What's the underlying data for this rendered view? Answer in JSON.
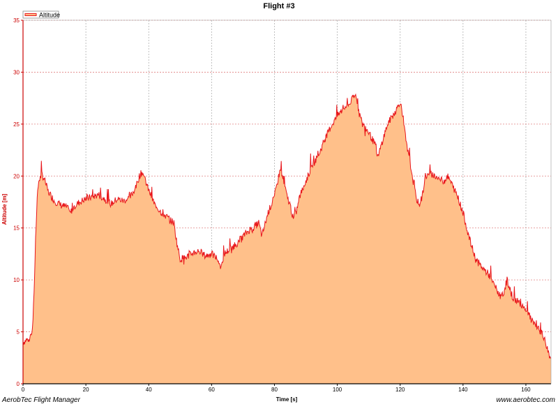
{
  "footer": {
    "left_text": "AerobTec Flight Manager",
    "right_text": "www.aerobtec.com"
  },
  "colors": {
    "fill": "#ffc08a",
    "line": "#e8161b",
    "grid": "#b0b0b0",
    "axis_y": "#cc0000",
    "axis_x": "#000000"
  },
  "chart_data": {
    "type": "area",
    "title": "Flight #3",
    "xlabel": "Time [s]",
    "ylabel": "Altitude [m]",
    "xlim": [
      0,
      168
    ],
    "ylim": [
      0,
      35
    ],
    "x_ticks": [
      0,
      20,
      40,
      60,
      80,
      100,
      120,
      140,
      160
    ],
    "y_ticks": [
      0,
      5,
      10,
      15,
      20,
      25,
      30,
      35
    ],
    "grid": true,
    "legend_position": "top-left",
    "series": [
      {
        "name": "Altitude",
        "x": [
          0,
          1,
          2,
          3,
          3.5,
          4,
          4.5,
          5,
          6,
          7,
          8,
          10,
          12,
          14,
          15,
          16,
          18,
          20,
          22,
          24,
          26,
          28,
          30,
          32,
          34,
          36,
          37,
          38,
          39,
          40,
          42,
          44,
          46,
          48,
          49,
          50,
          52,
          54,
          56,
          58,
          60,
          62,
          63,
          64,
          66,
          68,
          70,
          72,
          74,
          75,
          76,
          78,
          80,
          81,
          82,
          83,
          84,
          85,
          86,
          87,
          88,
          90,
          92,
          94,
          96,
          98,
          100,
          102,
          104,
          105,
          106,
          107,
          108,
          110,
          112,
          113,
          114,
          116,
          118,
          119,
          120,
          121,
          122,
          124,
          125,
          126,
          127,
          128,
          130,
          132,
          134,
          135,
          136,
          138,
          140,
          142,
          144,
          146,
          148,
          150,
          152,
          153,
          154,
          155,
          156,
          158,
          160,
          162,
          164,
          165,
          166,
          167,
          168
        ],
        "y": [
          4,
          4.2,
          4.3,
          5.2,
          8.5,
          14,
          18,
          19.5,
          20.2,
          19.5,
          18.5,
          17.6,
          17.2,
          17.0,
          16.4,
          17.0,
          17.5,
          17.8,
          18.0,
          18.2,
          17.8,
          17.3,
          17.8,
          17.6,
          17.9,
          19.0,
          20.0,
          20.4,
          19.5,
          18.6,
          17.2,
          16.5,
          16.0,
          15.5,
          13.5,
          12.0,
          12.2,
          12.6,
          12.8,
          12.3,
          12.5,
          12.0,
          11.2,
          12.5,
          13.0,
          13.5,
          14.2,
          14.8,
          15.2,
          15.5,
          14.2,
          16.5,
          18.0,
          19.5,
          20.8,
          19.5,
          18.0,
          17.2,
          15.8,
          16.6,
          18.0,
          19.5,
          21.0,
          22.0,
          23.5,
          24.8,
          25.8,
          26.5,
          27.0,
          27.5,
          27.8,
          26.0,
          25.0,
          24.2,
          23.0,
          21.8,
          23.0,
          25.0,
          26.0,
          26.5,
          27.2,
          25.5,
          23.0,
          20.0,
          18.0,
          17.2,
          18.0,
          20.0,
          20.2,
          19.8,
          19.5,
          20.0,
          19.5,
          18.2,
          16.5,
          14.0,
          12.0,
          11.2,
          10.6,
          9.5,
          8.3,
          8.8,
          10.0,
          9.0,
          8.2,
          7.8,
          7.2,
          6.0,
          5.2,
          5.0,
          4.2,
          3.2,
          2.5
        ]
      }
    ]
  }
}
